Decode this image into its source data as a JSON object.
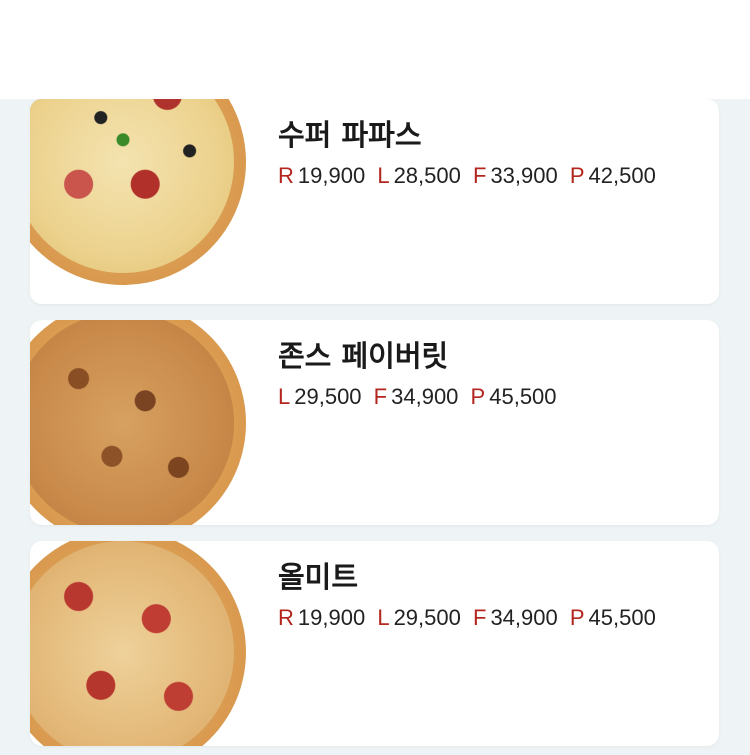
{
  "theme": {
    "size_code_color": "#b3261e",
    "background": "#eef4f5",
    "card": "#ffffff"
  },
  "menu": {
    "items": [
      {
        "name": "수퍼 파파스",
        "image_icon": "pizza-image-super-papas",
        "prices": [
          {
            "size": "R",
            "amount": "19,900"
          },
          {
            "size": "L",
            "amount": "28,500"
          },
          {
            "size": "F",
            "amount": "33,900"
          },
          {
            "size": "P",
            "amount": "42,500"
          }
        ]
      },
      {
        "name": "존스 페이버릿",
        "image_icon": "pizza-image-johns-favorite",
        "prices": [
          {
            "size": "L",
            "amount": "29,500"
          },
          {
            "size": "F",
            "amount": "34,900"
          },
          {
            "size": "P",
            "amount": "45,500"
          }
        ]
      },
      {
        "name": "올미트",
        "image_icon": "pizza-image-all-meat",
        "prices": [
          {
            "size": "R",
            "amount": "19,900"
          },
          {
            "size": "L",
            "amount": "29,500"
          },
          {
            "size": "F",
            "amount": "34,900"
          },
          {
            "size": "P",
            "amount": "45,500"
          }
        ]
      }
    ]
  }
}
